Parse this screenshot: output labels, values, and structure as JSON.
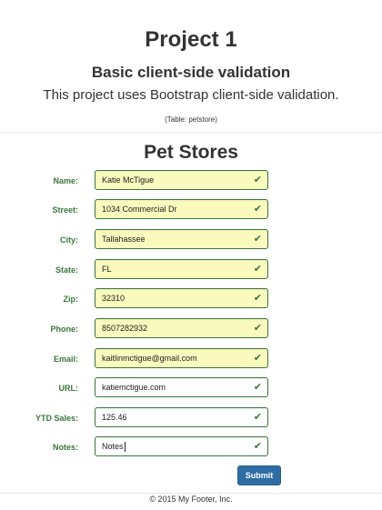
{
  "header": {
    "title": "Project 1",
    "subtitle": "Basic client-side validation",
    "description": "This project uses Bootstrap client-side validation.",
    "table_note": "(Table: petstore)"
  },
  "form": {
    "title": "Pet Stores",
    "fields": [
      {
        "label": "Name:",
        "value": "Katie McTigue"
      },
      {
        "label": "Street:",
        "value": "1034 Commercial Dr"
      },
      {
        "label": "City:",
        "value": "Tallahassee"
      },
      {
        "label": "State:",
        "value": "FL"
      },
      {
        "label": "Zip:",
        "value": "32310"
      },
      {
        "label": "Phone:",
        "value": "8507282932"
      },
      {
        "label": "Email:",
        "value": "kaitlinmctigue@gmail.com"
      },
      {
        "label": "URL:",
        "value": "katiemctigue.com"
      },
      {
        "label": "YTD Sales:",
        "value": "125.46"
      },
      {
        "label": "Notes:",
        "value": "Notes"
      }
    ],
    "submit_label": "Submit"
  },
  "footer": {
    "text": "© 2015 My Footer, Inc."
  },
  "colors": {
    "valid_green": "#3c763d",
    "autofill_yellow": "#fafabf",
    "primary_button": "#2e6da4"
  }
}
